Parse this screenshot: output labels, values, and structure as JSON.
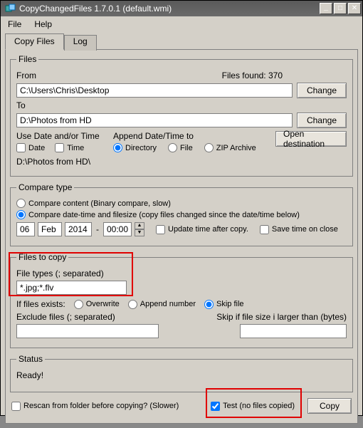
{
  "window": {
    "title": "CopyChangedFiles 1.7.0.1 (default.wmi)"
  },
  "menu": {
    "file": "File",
    "help": "Help"
  },
  "tabs": {
    "copy": "Copy Files",
    "log": "Log"
  },
  "files": {
    "legend": "Files",
    "from_label": "From",
    "from_value": "C:\\Users\\Chris\\Desktop",
    "to_label": "To",
    "to_value": "D:\\Photos from HD",
    "files_found": "Files found: 370",
    "change": "Change",
    "use_date_label": "Use Date and/or Time",
    "date": "Date",
    "time": "Time",
    "append_label": "Append Date/Time to",
    "directory": "Directory",
    "file": "File",
    "zip": "ZIP Archive",
    "open_dest": "Open destination",
    "preview": "D:\\Photos from HD\\"
  },
  "compare": {
    "legend": "Compare type",
    "content": "Compare content (Binary compare, slow)",
    "datetime": "Compare date-time and filesize (copy files changed since the date/time below)",
    "day": "06",
    "month": "Feb",
    "year": "2014",
    "sep": "-",
    "time": "00:00",
    "update_after": "Update time after copy.",
    "save_on_close": "Save time on close"
  },
  "filter": {
    "legend": "Files to copy",
    "types_label": "File types (; separated)",
    "types_value": "*.jpg;*.flv",
    "exists_label": "If files exists:",
    "overwrite": "Overwrite",
    "append_num": "Append number",
    "skip": "Skip file",
    "exclude_label": "Exclude files (; separated)",
    "skip_size_label": "Skip if file size i larger than (bytes)"
  },
  "status": {
    "legend": "Status",
    "text": "Ready!"
  },
  "bottom": {
    "rescan": "Rescan from folder before copying? (Slower)",
    "test": "Test (no files copied)",
    "copy": "Copy"
  }
}
